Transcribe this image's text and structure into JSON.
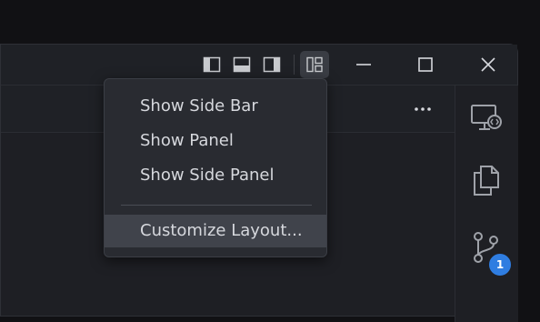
{
  "menu": {
    "items": [
      {
        "label": "Show Side Bar"
      },
      {
        "label": "Show Panel"
      },
      {
        "label": "Show Side Panel"
      }
    ],
    "customize_label": "Customize Layout..."
  },
  "activity_bar": {
    "source_control_badge": "1"
  },
  "icons": {
    "toggle_primary_sidebar": "sidebar-left-icon",
    "toggle_panel": "panel-bottom-icon",
    "toggle_secondary_sidebar": "sidebar-right-icon",
    "customize_layout": "layout-icon",
    "minimize": "minimize-icon",
    "maximize": "maximize-icon",
    "close": "close-icon",
    "more_actions": "ellipsis-icon",
    "remote_explorer": "remote-explorer-icon",
    "explorer": "files-icon",
    "source_control": "source-control-icon"
  },
  "colors": {
    "badge": "#2f7de1",
    "menu_bg": "#292b31",
    "menu_hover": "#40434b",
    "text": "#d6d8dd"
  }
}
